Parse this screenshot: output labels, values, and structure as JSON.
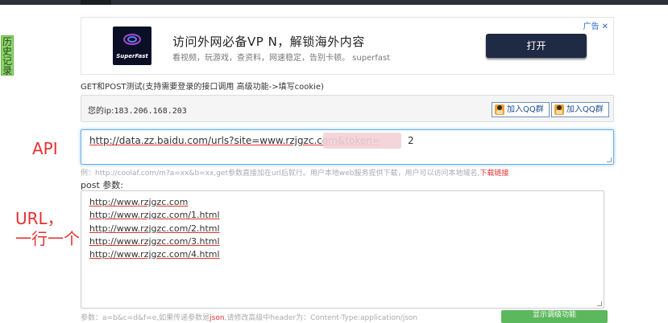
{
  "history_tab": "历史记录",
  "ad": {
    "label": "广告",
    "close": "✕",
    "logo_text": "SuperFast",
    "title": "访问外网必备VP N，解锁海外内容",
    "subtitle": "看视频，玩游戏，查资料，网速稳定，告别卡顿。 superfast",
    "button": "打开"
  },
  "subtitle": "GET和POST测试(支持需要登录的接口调用 高级功能->填写cookie)",
  "ip": {
    "label": "您的ip:",
    "value": "183.206.168.203"
  },
  "qq_buttons": [
    "加入QQ群",
    "加入QQ群"
  ],
  "side_labels": {
    "api": "API",
    "url_line1": "URL，",
    "url_line2": "一行一个"
  },
  "api_input": {
    "value": "http://data.zz.baidu.com/urls?site=www.rzjgzc.com&token=",
    "tail": "2"
  },
  "hint1": {
    "text": "例：http://coolaf.com/m?a=xx&b=xx,get参数直接加在url后就行。用户本地web服务提供下载，用户可以访问本地域名,",
    "link": "下载链接"
  },
  "post_label": "post 参数:",
  "post_lines": [
    "http://www.rzjgzc.com",
    "http://www.rzjgzc.com/1.html",
    "http://www.rzjgzc.com/2.html",
    "http://www.rzjgzc.com/3.html",
    "http://www.rzjgzc.com/4.html"
  ],
  "hint2": {
    "prefix": "参数：a=b&c=d&f=e,如果传递参数是",
    "json": "json",
    "suffix": ",请修改高级中header为：Content-Type:application/json"
  },
  "green_button": "显示调级功能"
}
